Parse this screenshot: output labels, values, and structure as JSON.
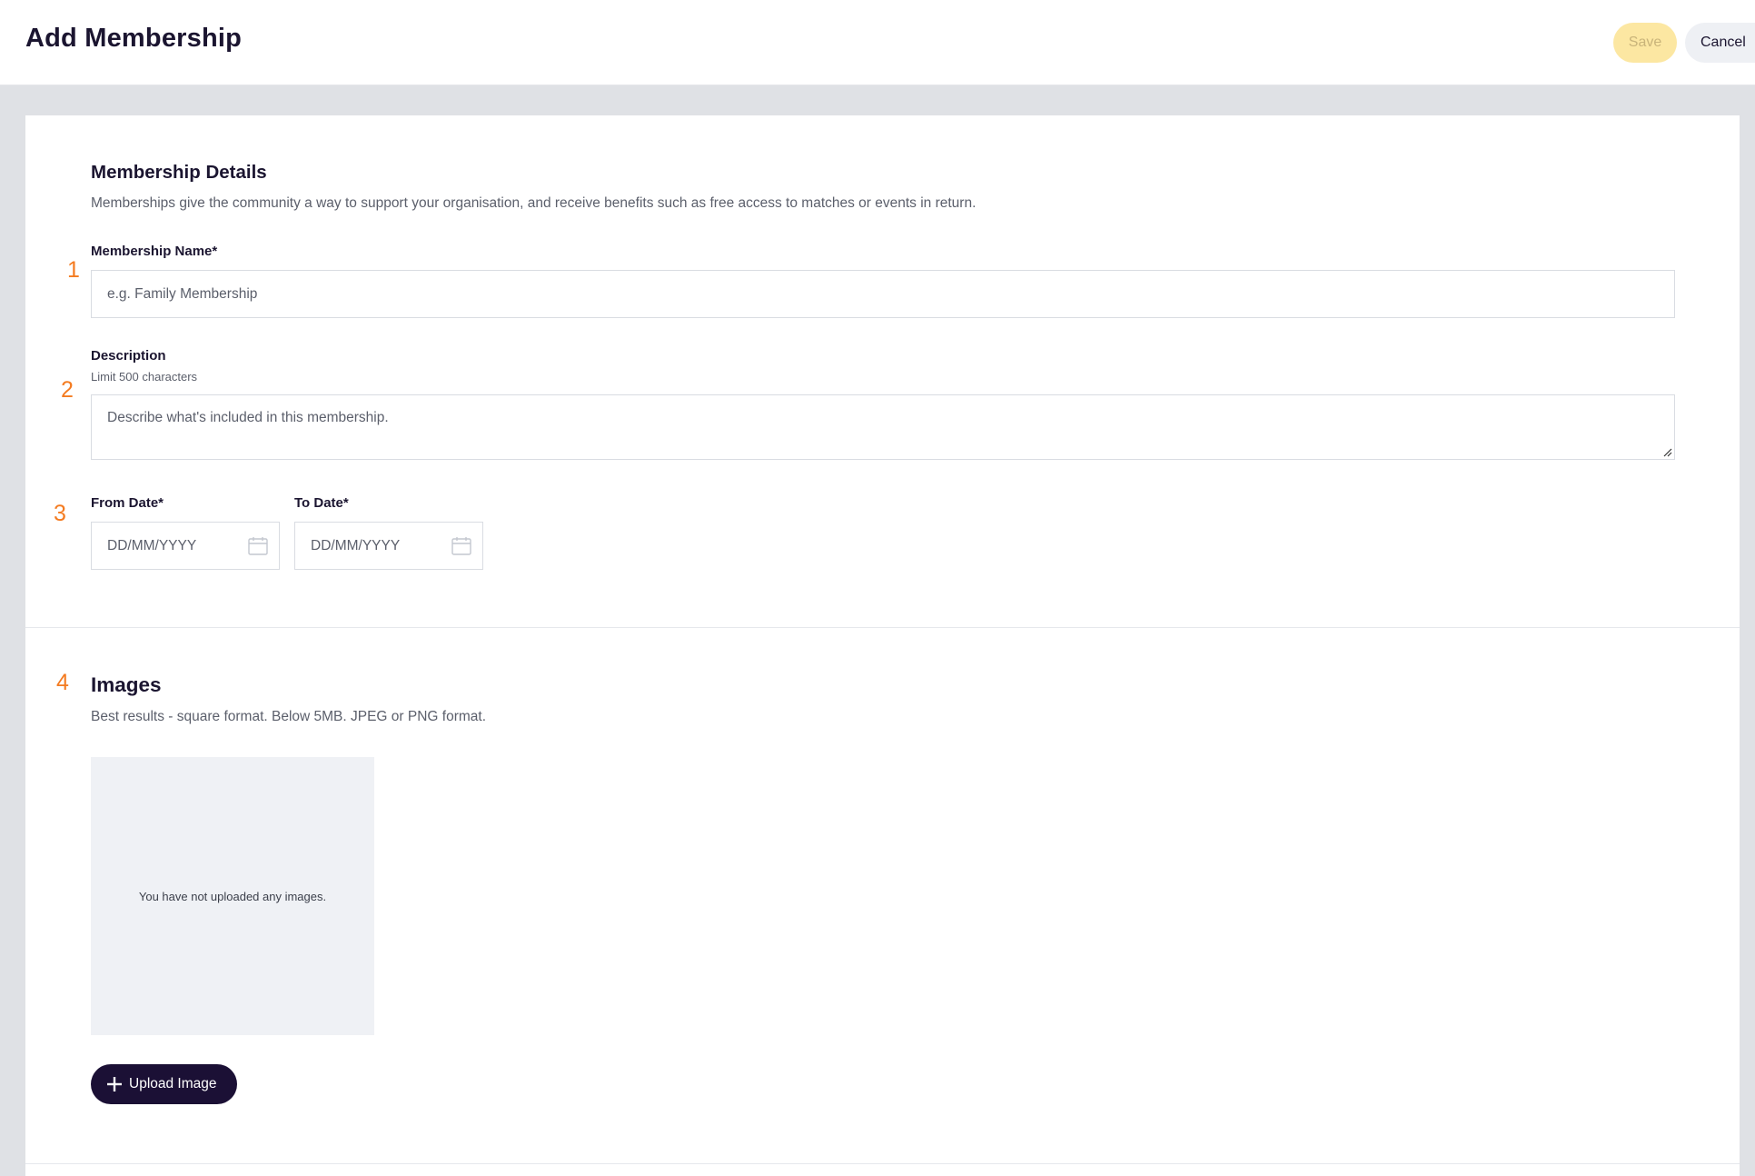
{
  "header": {
    "title": "Add Membership",
    "save_label": "Save",
    "cancel_label": "Cancel"
  },
  "details": {
    "number": "1",
    "title": "Membership Details",
    "helper": "Memberships give the community a way to support your organisation, and receive benefits such as free access to matches or events in return.",
    "name_label": "Membership Name*",
    "name_placeholder": "e.g. Family Membership",
    "description_number": "2",
    "description_label": "Description",
    "description_limit": "Limit 500 characters",
    "description_placeholder": "Describe what's included in this membership.",
    "dates_number": "3",
    "from_label": "From Date*",
    "from_placeholder": "DD/MM/YYYY",
    "to_label": "To Date*",
    "to_placeholder": "DD/MM/YYYY"
  },
  "images": {
    "number": "4",
    "title": "Images",
    "helper": "Best results - square format. Below 5MB. JPEG or PNG format.",
    "empty_text": "You have not uploaded any images.",
    "upload_label": "Upload Image"
  },
  "colors": {
    "accent_number": "#f47b20",
    "save_bg": "#fce7a2",
    "primary_dark": "#1b1035"
  }
}
